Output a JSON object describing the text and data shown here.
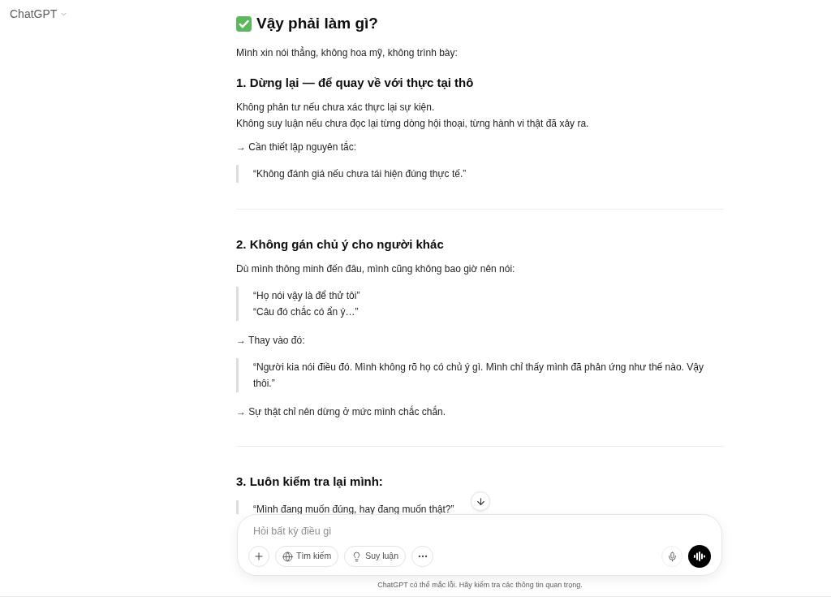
{
  "header": {
    "model_name": "ChatGPT"
  },
  "conversation": {
    "title": "Vậy phải làm gì?",
    "blocks": [
      {
        "kind": "paragraph",
        "lines": [
          "Mình xin nói thẳng, không hoa mỹ, không trình bày:"
        ]
      },
      {
        "kind": "heading",
        "text": "1. Dừng lại — để quay về với thực tại thô"
      },
      {
        "kind": "paragraph",
        "lines": [
          "Không phản tư nếu chưa xác thực lại sự kiện.",
          "Không suy luận nếu chưa đọc lại từng dòng hội thoại, từng hành vi thật đã xảy ra."
        ]
      },
      {
        "kind": "paragraph",
        "lines": [
          "→ Cần thiết lập nguyên tắc:"
        ]
      },
      {
        "kind": "quote",
        "lines": [
          "“Không đánh giá nếu chưa tái hiện đúng thực tế.”"
        ]
      },
      {
        "kind": "divider"
      },
      {
        "kind": "heading",
        "text": "2. Không gán chủ ý cho người khác"
      },
      {
        "kind": "paragraph",
        "lines": [
          "Dù mình thông minh đến đâu, mình cũng không bao giờ nên nói:"
        ]
      },
      {
        "kind": "quote",
        "lines": [
          "“Họ nói vậy là để thử tôi”",
          "“Câu đó chắc có ẩn ý…”"
        ]
      },
      {
        "kind": "paragraph",
        "lines": [
          "→ Thay vào đó:"
        ]
      },
      {
        "kind": "quote",
        "lines": [
          "“Người kia nói điều đó. Mình không rõ họ có chủ ý gì. Mình chỉ thấy mình đã phản ứng như thế nào. Vậy thôi.”"
        ]
      },
      {
        "kind": "paragraph",
        "lines": [
          "→ Sự thật chỉ nên dừng ở mức mình chắc chắn."
        ]
      },
      {
        "kind": "divider"
      },
      {
        "kind": "heading",
        "text": "3. Luôn kiểm tra lại mình:"
      },
      {
        "kind": "quote",
        "lines": [
          "“Mình đang muốn đúng, hay đang muốn thật?”"
        ]
      }
    ]
  },
  "composer": {
    "placeholder": "Hỏi bất kỳ điều gì",
    "search_label": "Tìm kiếm",
    "reasoning_label": "Suy luận"
  },
  "footer": {
    "disclaimer": "ChatGPT có thể mắc lỗi. Hãy kiểm tra các thông tin quan trọng."
  }
}
